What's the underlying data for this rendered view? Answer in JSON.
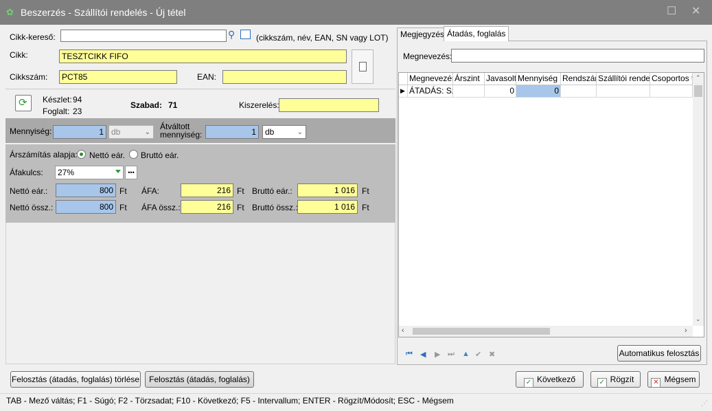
{
  "window": {
    "title": "Beszerzés - Szállítói rendelés - Új tétel"
  },
  "article": {
    "search_label": "Cikk-kereső:",
    "search_value": "",
    "search_hint": "(cikkszám, név, EAN, SN vagy LOT)",
    "name_label": "Cikk:",
    "name_value": "TESZTCIKK FIFO",
    "code_label": "Cikkszám:",
    "code_value": "PCT85",
    "ean_label": "EAN:",
    "ean_value": ""
  },
  "stock": {
    "keszlet_label": "Készlet:",
    "keszlet_value": "94",
    "foglalt_label": "Foglalt:",
    "foglalt_value": "23",
    "szabad_label": "Szabad:",
    "szabad_value": "71",
    "kiszereles_label": "Kiszerelés:",
    "kiszereles_value": ""
  },
  "quantity": {
    "label": "Mennyiség:",
    "value": "1",
    "unit": "db",
    "converted_label": "Átváltott mennyiség:",
    "converted_value": "1",
    "converted_unit": "db"
  },
  "pricing": {
    "basis_label": "Árszámítás alapja:",
    "option_net": "Nettó eár.",
    "option_gross": "Bruttó eár.",
    "selected": "net",
    "vat_label": "Áfakulcs:",
    "vat_value": "27%",
    "vat_more": "•••",
    "net_unit_label": "Nettó eár.:",
    "net_unit_value": "800",
    "vat_amount_label": "ÁFA:",
    "vat_amount_value": "216",
    "gross_unit_label": "Bruttó eár.:",
    "gross_unit_value": "1 016",
    "net_total_label": "Nettó össz.:",
    "net_total_value": "800",
    "vat_total_label": "ÁFA össz.:",
    "vat_total_value": "216",
    "gross_total_label": "Bruttó össz.:",
    "gross_total_value": "1 016",
    "currency": "Ft"
  },
  "right_panel": {
    "tabs": [
      {
        "label": "Megjegyzés"
      },
      {
        "label": "Átadás, foglalás"
      }
    ],
    "active_tab": 1,
    "name_label": "Megnevezés:",
    "name_value": "",
    "columns": [
      "Megnevezés",
      "Árszint",
      "Javasolt",
      "Mennyiség",
      "Rendszám",
      "Szállítói rendelé",
      "Csoportos te"
    ],
    "rows": [
      {
        "megnevezes": "ÁTADÁS: Sze",
        "arszint": "",
        "javasolt": "0",
        "mennyiseg": "0",
        "rendszam": "",
        "szallitoi": "",
        "csoportos": ""
      }
    ],
    "auto_button": "Automatikus felosztás"
  },
  "buttons": {
    "delete_split": "Felosztás (átadás, foglalás) törlése",
    "split": "Felosztás (átadás, foglalás)",
    "next": "Következő",
    "save": "Rögzít",
    "cancel": "Mégsem"
  },
  "statusbar": {
    "text": "TAB - Mező váltás; F1 - Súgó; F2 - Törzsadat;  F10 - Következő; F5 - Intervallum; ENTER - Rögzít/Módosít; ESC - Mégsem"
  }
}
